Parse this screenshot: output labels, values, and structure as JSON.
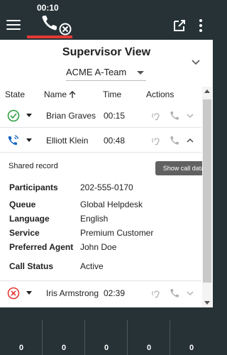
{
  "topbar": {
    "timer": "00:10",
    "icons": [
      "menu-icon",
      "phone-end-icon",
      "open-in-new-icon",
      "more-vert-icon"
    ],
    "underline_color": "#e53935"
  },
  "panel": {
    "title": "Supervisor View",
    "team": "ACME A-Team",
    "headers": {
      "state": "State",
      "name": "Name",
      "time": "Time",
      "actions": "Actions"
    }
  },
  "agents": [
    {
      "name": "Brian Graves",
      "time": "00:15",
      "state_icon": "check-circle-icon",
      "state_color": "#2e9e44"
    },
    {
      "name": "Elliott Klein",
      "time": "00:48",
      "state_icon": "phone-in-talk-icon",
      "state_color": "#1565c0"
    },
    {
      "name": "Iris Armstrong",
      "time": "02:39",
      "state_icon": "cancel-circle-icon",
      "state_color": "#e53935"
    }
  ],
  "details": {
    "shared": "Shared record",
    "participants_label": "Participants",
    "participants": "202-555-0170",
    "queue_label": "Queue",
    "queue": "Global Helpdesk",
    "language_label": "Language",
    "language": "English",
    "service_label": "Service",
    "service": "Premium Customer",
    "agent_label": "Preferred Agent",
    "agent": "John Doe",
    "status_label": "Call Status",
    "status": "Active"
  },
  "tooltip": "Show call data",
  "counters": [
    "0",
    "0",
    "0",
    "0",
    "0"
  ]
}
